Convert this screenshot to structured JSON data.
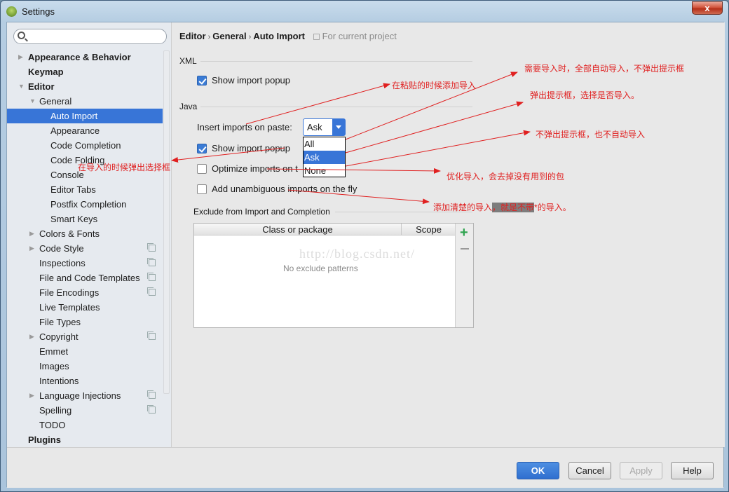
{
  "window": {
    "title": "Settings",
    "close_label": "x"
  },
  "sidebar": {
    "search_placeholder": "",
    "items": [
      {
        "label": "Appearance & Behavior",
        "level": 0,
        "bold": true,
        "arrow": "right",
        "project": false
      },
      {
        "label": "Keymap",
        "level": 0,
        "bold": true,
        "arrow": "",
        "project": false
      },
      {
        "label": "Editor",
        "level": 0,
        "bold": true,
        "arrow": "down",
        "project": false
      },
      {
        "label": "General",
        "level": 1,
        "bold": false,
        "arrow": "down",
        "project": false
      },
      {
        "label": "Auto Import",
        "level": 2,
        "bold": false,
        "arrow": "",
        "project": false,
        "selected": true
      },
      {
        "label": "Appearance",
        "level": 2,
        "bold": false,
        "arrow": "",
        "project": false
      },
      {
        "label": "Code Completion",
        "level": 2,
        "bold": false,
        "arrow": "",
        "project": false
      },
      {
        "label": "Code Folding",
        "level": 2,
        "bold": false,
        "arrow": "",
        "project": false
      },
      {
        "label": "Console",
        "level": 2,
        "bold": false,
        "arrow": "",
        "project": false
      },
      {
        "label": "Editor Tabs",
        "level": 2,
        "bold": false,
        "arrow": "",
        "project": false
      },
      {
        "label": "Postfix Completion",
        "level": 2,
        "bold": false,
        "arrow": "",
        "project": false
      },
      {
        "label": "Smart Keys",
        "level": 2,
        "bold": false,
        "arrow": "",
        "project": false
      },
      {
        "label": "Colors & Fonts",
        "level": 1,
        "bold": false,
        "arrow": "right",
        "project": false
      },
      {
        "label": "Code Style",
        "level": 1,
        "bold": false,
        "arrow": "right",
        "project": true
      },
      {
        "label": "Inspections",
        "level": 1,
        "bold": false,
        "arrow": "",
        "project": true
      },
      {
        "label": "File and Code Templates",
        "level": 1,
        "bold": false,
        "arrow": "",
        "project": true
      },
      {
        "label": "File Encodings",
        "level": 1,
        "bold": false,
        "arrow": "",
        "project": true
      },
      {
        "label": "Live Templates",
        "level": 1,
        "bold": false,
        "arrow": "",
        "project": false
      },
      {
        "label": "File Types",
        "level": 1,
        "bold": false,
        "arrow": "",
        "project": false
      },
      {
        "label": "Copyright",
        "level": 1,
        "bold": false,
        "arrow": "right",
        "project": true
      },
      {
        "label": "Emmet",
        "level": 1,
        "bold": false,
        "arrow": "",
        "project": false
      },
      {
        "label": "Images",
        "level": 1,
        "bold": false,
        "arrow": "",
        "project": false
      },
      {
        "label": "Intentions",
        "level": 1,
        "bold": false,
        "arrow": "",
        "project": false
      },
      {
        "label": "Language Injections",
        "level": 1,
        "bold": false,
        "arrow": "right",
        "project": true
      },
      {
        "label": "Spelling",
        "level": 1,
        "bold": false,
        "arrow": "",
        "project": true
      },
      {
        "label": "TODO",
        "level": 1,
        "bold": false,
        "arrow": "",
        "project": false
      },
      {
        "label": "Plugins",
        "level": 0,
        "bold": true,
        "arrow": "",
        "project": false
      }
    ]
  },
  "breadcrumb": {
    "items": [
      "Editor",
      "General",
      "Auto Import"
    ],
    "separator": "›",
    "scope_note": "For current project"
  },
  "xml_section": {
    "label": "XML",
    "show_import_popup": {
      "label": "Show import popup",
      "checked": true
    }
  },
  "java_section": {
    "label": "Java",
    "insert_imports_label": "Insert imports on paste:",
    "insert_imports_value": "Ask",
    "insert_imports_options": [
      "All",
      "Ask",
      "None"
    ],
    "show_import_popup": {
      "label": "Show import popup",
      "checked": true
    },
    "optimize_imports": {
      "label": "Optimize imports on the fly",
      "visible_label": "Optimize imports on t",
      "checked": false
    },
    "add_unambiguous": {
      "label": "Add unambiguous imports on the fly",
      "checked": false
    }
  },
  "exclude_section": {
    "label": "Exclude from Import and Completion",
    "columns": [
      "Class or package",
      "Scope"
    ],
    "empty_text": "No exclude patterns",
    "watermark": "http://blog.csdn.net/",
    "add_label": "+",
    "remove_label": "−"
  },
  "footer": {
    "ok_label": "OK",
    "cancel_label": "Cancel",
    "apply_label": "Apply",
    "help_label": "Help"
  },
  "annotations": {
    "paste": "在粘贴的时候添加导入",
    "all": "需要导入时，全部自动导入，不弹出提示框",
    "ask": "弹出提示框，选择是否导入。",
    "none": "不弹出提示框，也不自动导入",
    "popup": "在导入的时候弹出选择框",
    "optimize": "优化导入，会去掉没有用到的包",
    "unambiguous_prefix": "添加清楚的导入",
    "unambiguous_highlight": "，就是不带",
    "unambiguous_suffix": "*的导入。",
    "color": "#e02020"
  }
}
